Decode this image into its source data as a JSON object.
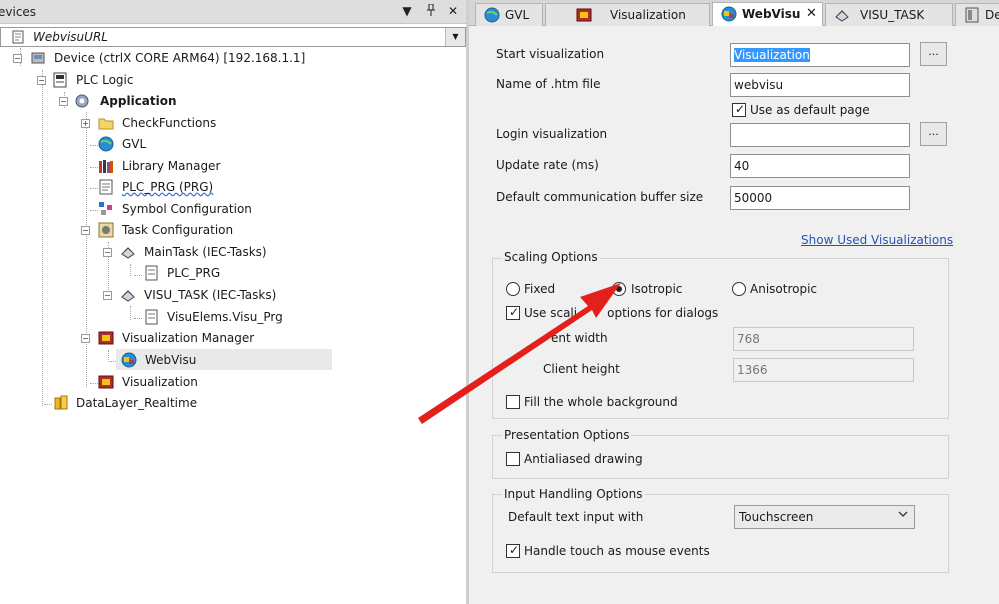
{
  "devices_pane": {
    "title": "evices",
    "dropdown_btn": "▼",
    "pin_btn": "ꟷ",
    "close_btn": "✕",
    "root": "WebvisuURL",
    "tree": [
      {
        "label": "Device (ctrlX CORE ARM64) [192.168.1.1]"
      },
      {
        "label": "PLC Logic"
      },
      {
        "label": "Application"
      },
      {
        "label": "CheckFunctions"
      },
      {
        "label": "GVL"
      },
      {
        "label": "Library Manager"
      },
      {
        "label": "PLC_PRG (PRG)"
      },
      {
        "label": "Symbol Configuration"
      },
      {
        "label": "Task Configuration"
      },
      {
        "label": "MainTask (IEC-Tasks)"
      },
      {
        "label": "PLC_PRG"
      },
      {
        "label": "VISU_TASK (IEC-Tasks)"
      },
      {
        "label": "VisuElems.Visu_Prg"
      },
      {
        "label": "Visualization Manager"
      },
      {
        "label": "WebVisu"
      },
      {
        "label": "Visualization"
      },
      {
        "label": "DataLayer_Realtime"
      }
    ]
  },
  "tabs": [
    {
      "label": "GVL"
    },
    {
      "label": "Visualization"
    },
    {
      "label": "WebVisu",
      "close": "✕"
    },
    {
      "label": "VISU_TASK"
    },
    {
      "label": "De"
    }
  ],
  "form": {
    "start_visualization": {
      "label": "Start visualization",
      "value": "Visualization",
      "btn": "..."
    },
    "htm_file": {
      "label": "Name of .htm file",
      "value": "webvisu"
    },
    "default_page": {
      "label": "Use as default page",
      "checked": true
    },
    "login_visualization": {
      "label": "Login visualization",
      "value": "",
      "btn": "..."
    },
    "update_rate": {
      "label": "Update rate (ms)",
      "value": "40"
    },
    "buffer_size": {
      "label": "Default communication buffer size",
      "value": "50000"
    },
    "show_used_link": "Show Used Visualizations"
  },
  "scaling": {
    "title": "Scaling Options",
    "fixed": "Fixed",
    "isotropic": "Isotropic",
    "anisotropic": "Anisotropic",
    "selected": "isotropic",
    "dialogs_prefix": "Use scali",
    "dialogs_suffix": "options for dialogs",
    "client_width_label": "ent width",
    "client_width_value": "768",
    "client_height_label": "Client height",
    "client_height_value": "1366",
    "fill_background": "Fill the whole background"
  },
  "presentation": {
    "title": "Presentation Options",
    "antialiased": "Antialiased drawing"
  },
  "input": {
    "title": "Input Handling Options",
    "default_text_label": "Default text input with",
    "default_text_value": "Touchscreen",
    "touch_as_mouse": "Handle touch as mouse events"
  },
  "colors": {
    "arrow": "#e3201b",
    "link": "#2452b8",
    "selection": "#3399ff"
  }
}
